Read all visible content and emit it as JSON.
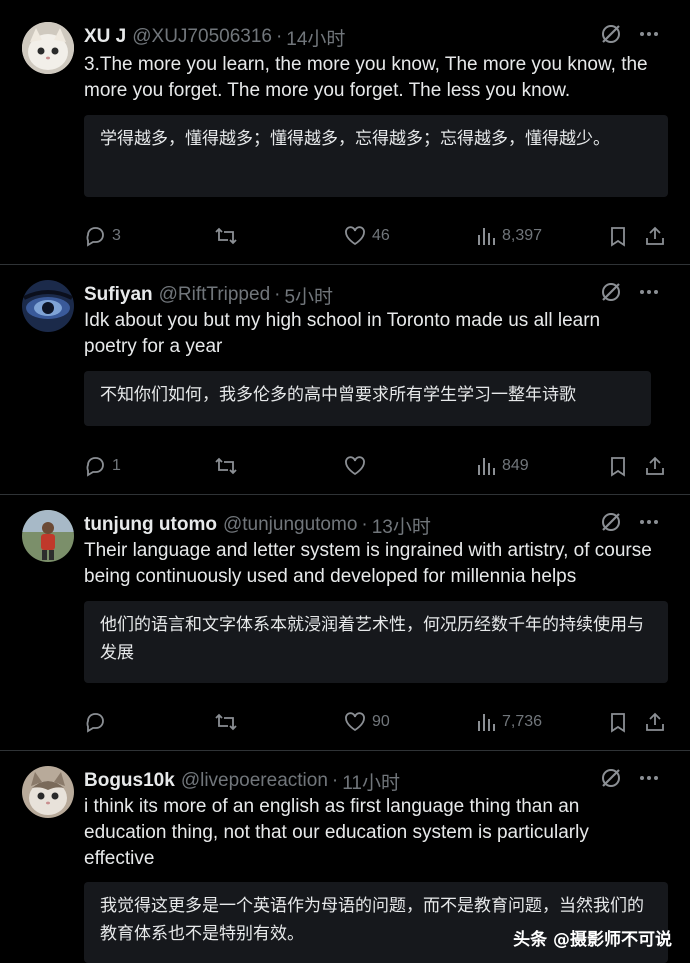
{
  "tweets": [
    {
      "name": "XU J",
      "handle": "@XUJ70506316",
      "sep": "·",
      "time": "14小时",
      "text": "3.The more you learn, the more you know, The more you know, the more you forget. The more you forget. The less you know.",
      "translation": "学得越多，懂得越多；懂得越多，忘得越多；忘得越多，懂得越少。",
      "replies": "3",
      "likes": "46",
      "views": "8,397"
    },
    {
      "name": "Sufiyan",
      "handle": "@RiftTripped",
      "sep": "·",
      "time": "5小时",
      "text": "Idk about you but my high school in Toronto made us all learn poetry for a year",
      "translation": "不知你们如何，我多伦多的高中曾要求所有学生学习一整年诗歌",
      "replies": "1",
      "likes": "",
      "views": "849"
    },
    {
      "name": "tunjung utomo",
      "handle": "@tunjungutomo",
      "sep": "·",
      "time": "13小时",
      "text": "Their language and letter system is ingrained with artistry, of course being continuously used and developed for millennia helps",
      "translation": "他们的语言和文字体系本就浸润着艺术性，何况历经数千年的持续使用与发展",
      "replies": "",
      "likes": "90",
      "views": "7,736"
    },
    {
      "name": "Bogus10k",
      "handle": "@livepoereaction",
      "sep": "·",
      "time": "11小时",
      "text": "i think its more of an english as first language thing than an education thing, not that our education system is particularly effective",
      "translation": "我觉得这更多是一个英语作为母语的问题，而不是教育问题，当然我们的教育体系也不是特别有效。"
    }
  ],
  "watermark": "头条 @摄影师不可说",
  "colors": {
    "background": "#000000",
    "text": "#e7e9ea",
    "muted": "#71767b",
    "translation_bg": "#16181c",
    "divider": "#2f3336"
  },
  "icons": [
    "grok-icon",
    "more-icon",
    "reply-icon",
    "retweet-icon",
    "like-icon",
    "views-icon",
    "bookmark-icon",
    "share-icon"
  ]
}
